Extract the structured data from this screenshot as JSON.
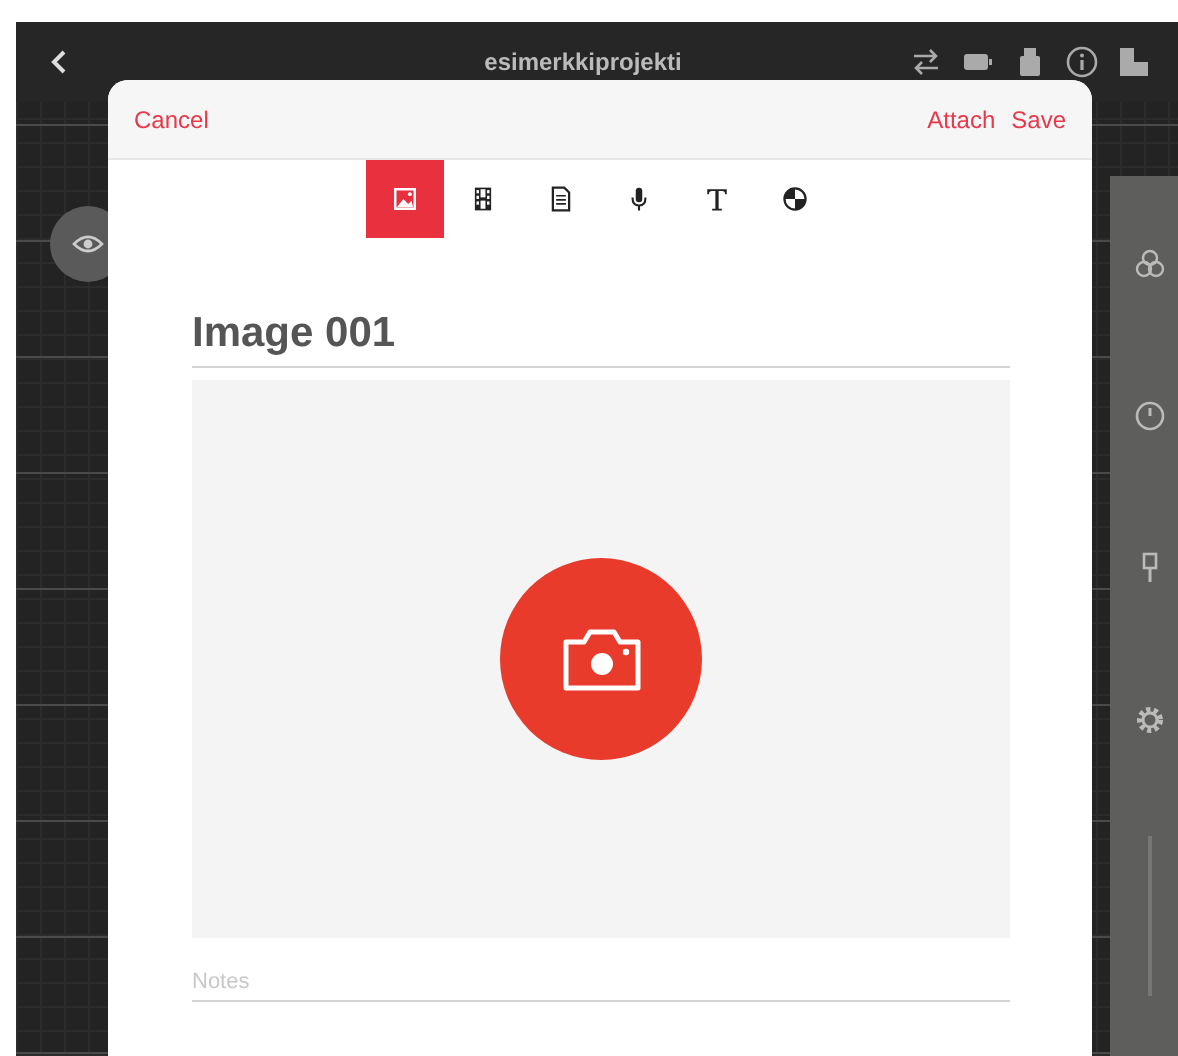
{
  "top_bar": {
    "title": "esimerkkiprojekti"
  },
  "sheet": {
    "cancel": "Cancel",
    "actions": [
      "Attach",
      "Save"
    ],
    "types": [
      {
        "kind": "image",
        "selected": true
      },
      {
        "kind": "video",
        "selected": false
      },
      {
        "kind": "document",
        "selected": false
      },
      {
        "kind": "audio",
        "selected": false
      },
      {
        "kind": "text",
        "selected": false
      },
      {
        "kind": "sketch",
        "selected": false
      }
    ],
    "title_value": "Image 001",
    "notes": {
      "placeholder": "Notes"
    }
  }
}
